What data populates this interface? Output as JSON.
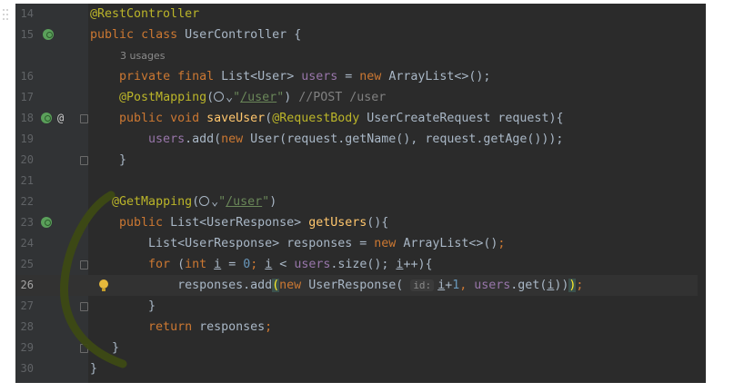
{
  "editor": {
    "usages_hint": "3 usages",
    "param_hint": "id:",
    "lines": [
      {
        "num": "14"
      },
      {
        "num": "15"
      },
      {
        "num": "16"
      },
      {
        "num": "17"
      },
      {
        "num": "18"
      },
      {
        "num": "19"
      },
      {
        "num": "20"
      },
      {
        "num": "21"
      },
      {
        "num": "22"
      },
      {
        "num": "23"
      },
      {
        "num": "24"
      },
      {
        "num": "25"
      },
      {
        "num": "26"
      },
      {
        "num": "27"
      },
      {
        "num": "28"
      },
      {
        "num": "29"
      },
      {
        "num": "30"
      }
    ],
    "current_line": "26"
  },
  "tokens": {
    "rest_controller": "@RestController",
    "public": "public",
    "class": "class",
    "user_controller": "UserController",
    "open_brace": "{",
    "close_brace": "}",
    "private": "private",
    "final": "final",
    "list_user": "List<User>",
    "users": "users",
    "eq": "=",
    "new": "new",
    "arraylist": "ArrayList<>();",
    "arraylist_call": "ArrayList<>()",
    "semi": ";",
    "post_mapping": "@PostMapping",
    "get_mapping": "@GetMapping",
    "open_paren": "(",
    "globe_chev": "⌄",
    "quote": "\"",
    "path_user": "/user",
    "close_paren": ")",
    "post_comment": "//POST /user",
    "void": "void",
    "save_user": "saveUser",
    "request_body": "@RequestBody",
    "user_create_request": "UserCreateRequest",
    "request": "request",
    "close_brace_sig": "){",
    "add": ".add(",
    "user_ctor": "User(",
    "get_name": "request.getName(),",
    "get_age": "request.getAge()));",
    "list_user_response": "List<UserResponse>",
    "get_users": "getUsers",
    "empty_sig": "(){",
    "responses": "responses",
    "for": "for",
    "int": "int",
    "i": "i",
    "zero": "0",
    "lt": "<",
    "size_call": ".size();",
    "inc": "++){",
    "responses_add": "responses.add",
    "user_response_ctor": "UserResponse(",
    "plus_one": "1",
    "plus": "+",
    "comma": ",",
    "users_get": ".get(",
    "close_two": "))",
    "return": "return",
    "close_three": "));"
  }
}
